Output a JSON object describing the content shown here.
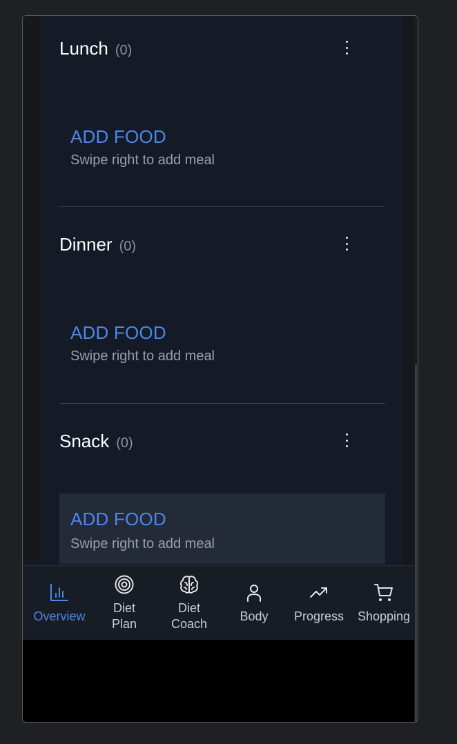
{
  "meals": [
    {
      "title": "Lunch",
      "count": "(0)",
      "add_label": "ADD FOOD",
      "hint": "Swipe right to add meal"
    },
    {
      "title": "Dinner",
      "count": "(0)",
      "add_label": "ADD FOOD",
      "hint": "Swipe right to add meal"
    },
    {
      "title": "Snack",
      "count": "(0)",
      "add_label": "ADD FOOD",
      "hint": "Swipe right to add meal"
    }
  ],
  "tabs": [
    {
      "label": "Overview",
      "icon": "bar-chart-icon",
      "active": true
    },
    {
      "label": "Diet\nPlan",
      "icon": "target-icon",
      "active": false
    },
    {
      "label": "Diet\nCoach",
      "icon": "brain-icon",
      "active": false
    },
    {
      "label": "Body",
      "icon": "person-icon",
      "active": false
    },
    {
      "label": "Progress",
      "icon": "trending-up-icon",
      "active": false
    },
    {
      "label": "Shopping",
      "icon": "cart-icon",
      "active": false
    }
  ],
  "colors": {
    "accent": "#4f86e8",
    "background": "#141b27",
    "tabbar": "#181c24"
  }
}
